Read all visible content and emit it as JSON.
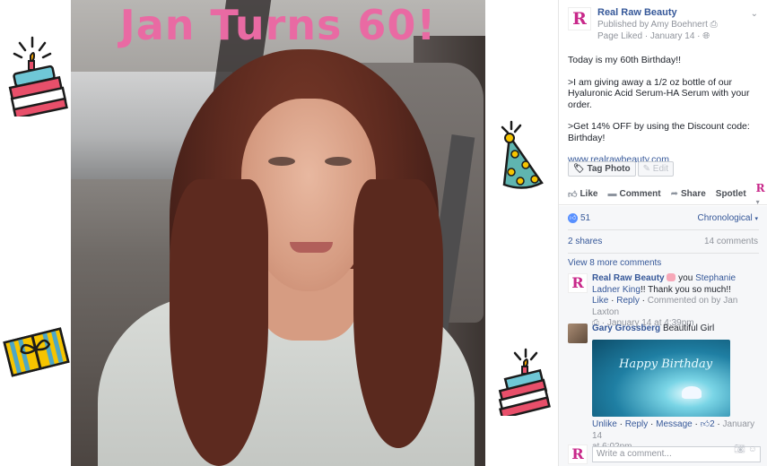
{
  "photo": {
    "title": "Jan Turns 60!"
  },
  "post": {
    "page_name": "Real Raw Beauty",
    "published_by": "Published by Amy Boehnert",
    "page_liked": "Page Liked · January 14 · ",
    "logo_letter": "R",
    "paragraphs": [
      "Today is my 60th Birthday!!",
      ">I am giving away a 1/2 oz bottle of our Hyaluronic Acid Serum-HA Serum with your order.",
      ">Get 14% OFF by using the Discount code: Birthday!"
    ],
    "url": "www.realrawbeauty.com",
    "tag_photo": "Tag Photo",
    "edit": "Edit"
  },
  "actions": {
    "like": "Like",
    "comment": "Comment",
    "share": "Share",
    "spotlet": "Spotlet"
  },
  "stats": {
    "likes": "51",
    "order": "Chronological",
    "shares": "2 shares",
    "comments": "14 comments",
    "view_more": "View 8 more comments"
  },
  "comments": [
    {
      "author": "Real Raw Beauty",
      "text_a": " you ",
      "mention": "Stephanie Ladner King",
      "text_b": "!! Thank you so much!!",
      "meta_like": "Like",
      "meta_reply": "Reply",
      "meta_commented": "Commented on by Jan Laxton",
      "meta_time": "January 14 at 4:39pm"
    },
    {
      "author": "Gary Grossberg",
      "text": "Beautiful Girl",
      "image_text": "Happy Birthday",
      "meta_unlike": "Unlike",
      "meta_reply": "Reply",
      "meta_message": "Message",
      "meta_likes": "2",
      "meta_time_a": "January 14",
      "meta_time_b": "at 6:02pm"
    }
  ],
  "write": {
    "placeholder": "Write a comment..."
  },
  "colors": {
    "title_pink": "#e96aa3",
    "fb_link": "#365899",
    "brand": "#c8288a"
  }
}
